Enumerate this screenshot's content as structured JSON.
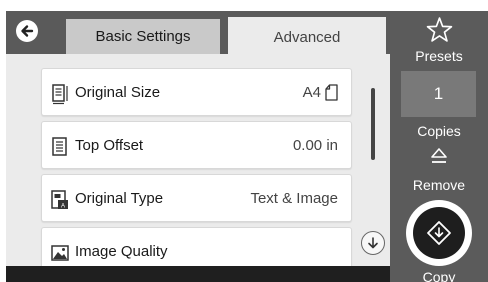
{
  "tabs": {
    "basic": "Basic Settings",
    "advanced": "Advanced"
  },
  "settings": [
    {
      "label": "Original Size",
      "value": "A4",
      "icon": "original-size-icon"
    },
    {
      "label": "Top Offset",
      "value": "0.00 in",
      "icon": "top-offset-icon"
    },
    {
      "label": "Original Type",
      "value": "Text & Image",
      "icon": "original-type-icon"
    },
    {
      "label": "Image Quality",
      "value": "",
      "icon": "image-quality-icon"
    }
  ],
  "side": {
    "presets": "Presets",
    "copies_value": "1",
    "copies": "Copies",
    "remove": "Remove",
    "copy": "Copy"
  },
  "colors": {
    "dark_panel": "#5b5b5b",
    "list_bg": "#ebebeb",
    "active_tab": "#ebebeb",
    "inactive_tab": "#c9c9c9"
  }
}
